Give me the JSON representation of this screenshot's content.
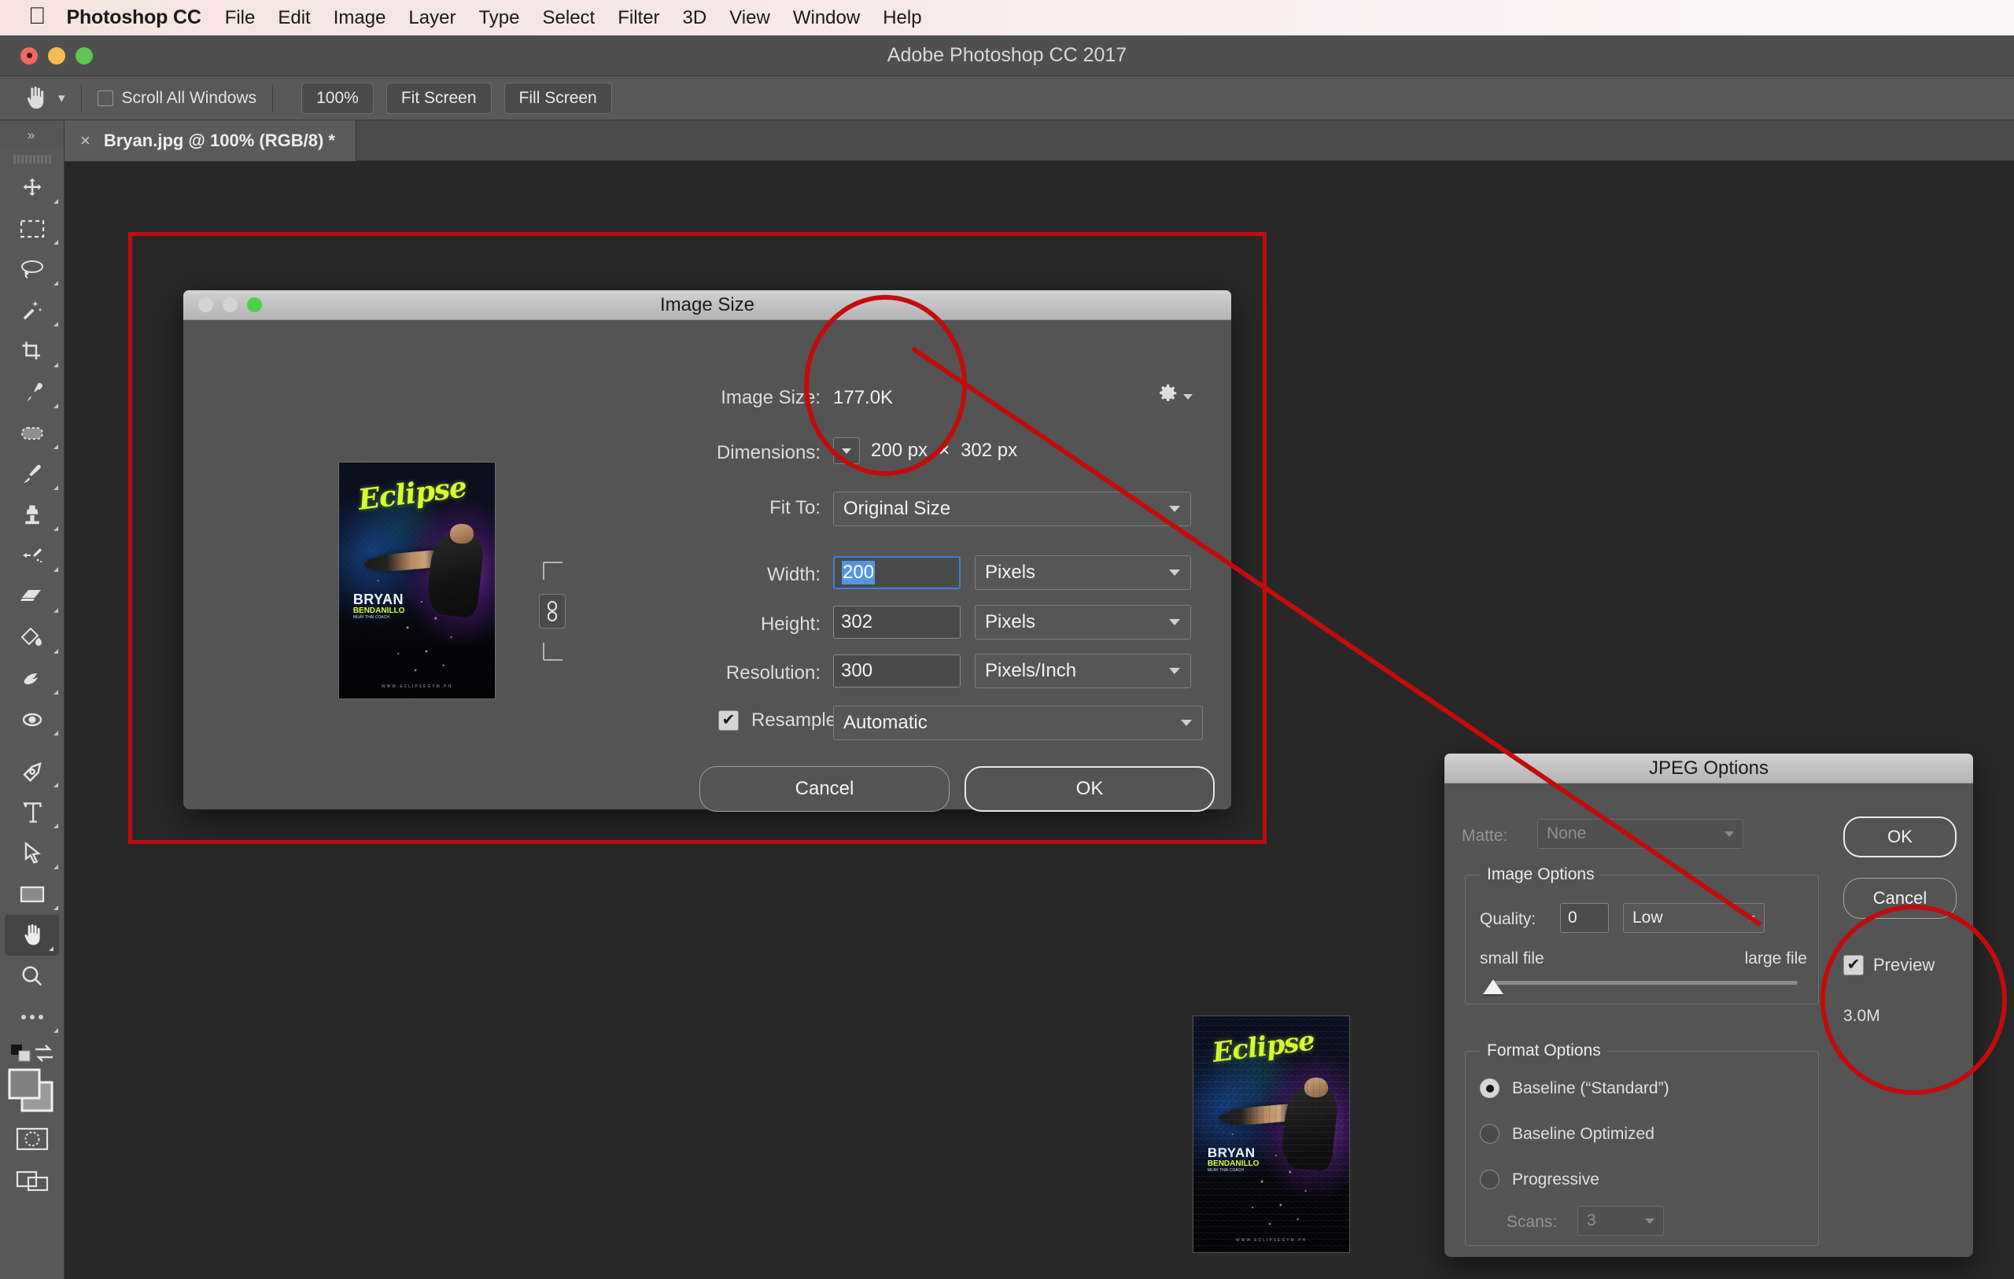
{
  "macos_menu": {
    "apple_icon": "apple-icon",
    "app_name": "Photoshop CC",
    "items": [
      "File",
      "Edit",
      "Image",
      "Layer",
      "Type",
      "Select",
      "Filter",
      "3D",
      "View",
      "Window",
      "Help"
    ]
  },
  "app_window": {
    "title": "Adobe Photoshop CC 2017"
  },
  "options_bar": {
    "tool_icon": "hand-tool-icon",
    "tool_preset_caret": "chevron-down-icon",
    "scroll_all_windows_label": "Scroll All Windows",
    "scroll_all_windows_checked": false,
    "buttons": [
      "100%",
      "Fit Screen",
      "Fill Screen"
    ]
  },
  "document_tab": {
    "close_glyph": "×",
    "label": "Bryan.jpg @ 100% (RGB/8) *"
  },
  "toolbar": {
    "collapse_glyph": "»",
    "tools": [
      {
        "name": "move-tool",
        "icon": "move-icon"
      },
      {
        "name": "rectangular-marquee-tool",
        "icon": "marquee-icon"
      },
      {
        "name": "lasso-tool",
        "icon": "lasso-icon"
      },
      {
        "name": "quick-selection-tool",
        "icon": "magic-wand-icon"
      },
      {
        "name": "crop-tool",
        "icon": "crop-icon"
      },
      {
        "name": "eyedropper-tool",
        "icon": "eyedropper-icon"
      },
      {
        "name": "spot-healing-brush-tool",
        "icon": "healing-brush-icon"
      },
      {
        "name": "brush-tool",
        "icon": "brush-icon"
      },
      {
        "name": "clone-stamp-tool",
        "icon": "stamp-icon"
      },
      {
        "name": "history-brush-tool",
        "icon": "history-brush-icon"
      },
      {
        "name": "eraser-tool",
        "icon": "eraser-icon"
      },
      {
        "name": "gradient-tool",
        "icon": "paint-bucket-icon"
      },
      {
        "name": "blur-tool",
        "icon": "blur-finger-icon"
      },
      {
        "name": "dodge-tool",
        "icon": "dodge-icon"
      },
      {
        "name": "pen-tool",
        "icon": "pen-icon"
      },
      {
        "name": "type-tool",
        "icon": "text-t-icon"
      },
      {
        "name": "path-selection-tool",
        "icon": "arrow-cursor-icon"
      },
      {
        "name": "rectangle-tool",
        "icon": "rectangle-icon"
      },
      {
        "name": "hand-tool",
        "icon": "hand-icon",
        "active": true
      },
      {
        "name": "zoom-tool",
        "icon": "magnifier-icon"
      },
      {
        "name": "edit-toolbar",
        "icon": "ellipsis-icon"
      }
    ],
    "color_swatches": {
      "foreground": "#808080",
      "background": "#9a9a9a",
      "swap_icon": "swap-arrows-icon",
      "default_icon": "default-colors-icon"
    },
    "quick_mask": "quick-mask-icon",
    "screen_mode": "screen-mode-icon"
  },
  "image_size_dialog": {
    "title": "Image Size",
    "traffic_lights": [
      "close",
      "minimize",
      "zoom"
    ],
    "gear_icon": "gear-icon",
    "fields": {
      "image_size_label": "Image Size:",
      "image_size_value": "177.0K",
      "dimensions_label": "Dimensions:",
      "dimensions_menu_icon": "chevron-down-icon",
      "dimensions_width": "200 px",
      "dimensions_times": "×",
      "dimensions_height": "302 px",
      "fit_to_label": "Fit To:",
      "fit_to_value": "Original Size",
      "width_label": "Width:",
      "width_value": "200",
      "width_unit": "Pixels",
      "height_label": "Height:",
      "height_value": "302",
      "height_unit": "Pixels",
      "resolution_label": "Resolution:",
      "resolution_value": "300",
      "resolution_unit": "Pixels/Inch",
      "resample_label": "Resample:",
      "resample_value": "Automatic",
      "resample_checked": true,
      "chain_icon": "link-chain-icon"
    },
    "buttons": {
      "cancel": "Cancel",
      "ok": "OK"
    },
    "preview_poster": {
      "logo": "Eclipse",
      "name": "BRYAN",
      "surname": "BENDANILLO",
      "role": "MUAY THAI COACH",
      "url": "WWW.ECLIPSEGYM.PH"
    }
  },
  "jpeg_options_dialog": {
    "title": "JPEG Options",
    "matte_label": "Matte:",
    "matte_value": "None",
    "matte_disabled": true,
    "image_options_group": "Image Options",
    "quality_label": "Quality:",
    "quality_value": "0",
    "quality_preset": "Low",
    "slider_min_label": "small file",
    "slider_max_label": "large file",
    "slider_position_pct": 0,
    "format_options_group": "Format Options",
    "format_choices": [
      {
        "label": "Baseline (“Standard”)",
        "selected": true
      },
      {
        "label": "Baseline Optimized",
        "selected": false
      },
      {
        "label": "Progressive",
        "selected": false
      }
    ],
    "scans_label": "Scans:",
    "scans_value": "3",
    "scans_disabled": true,
    "ok_label": "OK",
    "cancel_label": "Cancel",
    "preview_label": "Preview",
    "preview_checked": true,
    "file_size": "3.0M"
  },
  "canvas": {
    "poster": {
      "logo": "Eclipse",
      "name": "BRYAN",
      "surname": "BENDANILLO",
      "role": "MUAY THAI COACH",
      "url": "WWW.ECLIPSEGYM.PH"
    }
  },
  "annotations": {
    "accent_color": "#c20c0c",
    "rect_label": "image-size-dialog-highlight",
    "ellipse_1_label": "dimensions-highlight",
    "ellipse_2_label": "preview-filesize-highlight",
    "connector_label": "connector-line"
  }
}
